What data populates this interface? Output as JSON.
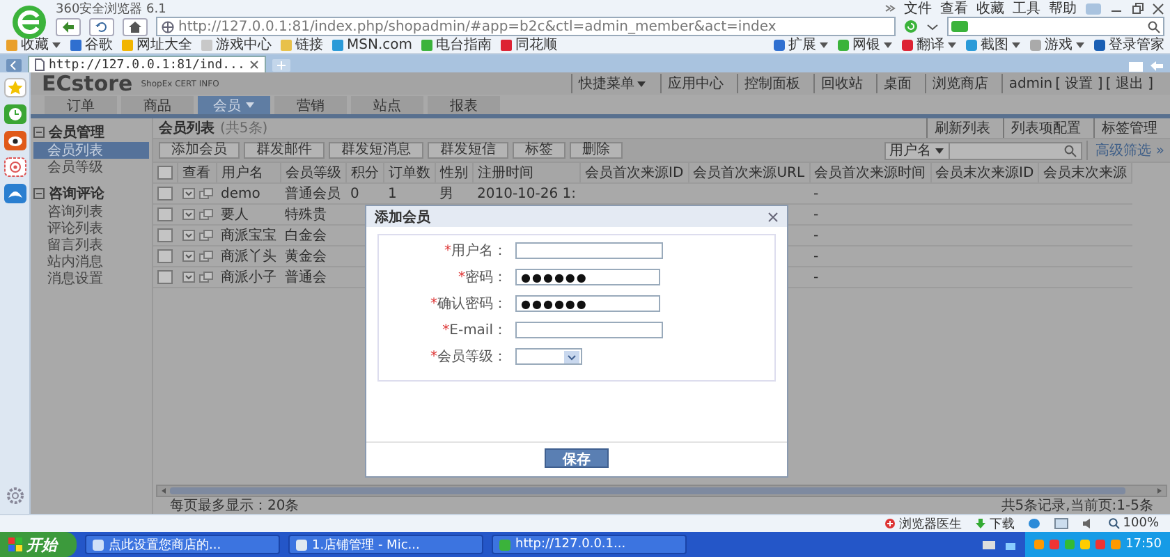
{
  "browser": {
    "title": "360安全浏览器 6.1",
    "menu": [
      "文件",
      "查看",
      "收藏",
      "工具",
      "帮助"
    ],
    "url": "http://127.0.0.1:81/index.php/shopadmin/#app=b2c&ctl=admin_member&act=index",
    "favorites": [
      {
        "label": "收藏",
        "dropdown": true
      },
      {
        "label": "谷歌",
        "dropdown": false
      },
      {
        "label": "网址大全",
        "dropdown": false
      },
      {
        "label": "游戏中心",
        "dropdown": false
      },
      {
        "label": "链接",
        "dropdown": false
      },
      {
        "label": "MSN.com",
        "dropdown": false
      },
      {
        "label": "电台指南",
        "dropdown": false
      },
      {
        "label": "同花顺",
        "dropdown": false
      }
    ],
    "tools": [
      "扩展",
      "网银",
      "翻译",
      "截图",
      "游戏",
      "登录管家"
    ],
    "tabs": [
      {
        "title": "http://127.0.0.1:81/ind...",
        "selected": true
      }
    ]
  },
  "app": {
    "logo": "ECstore",
    "subtitle": "ShopEx CERT INFO",
    "quick_menu": "快捷菜单",
    "top_links": [
      "应用中心",
      "控制面板",
      "回收站",
      "桌面",
      "浏览商店"
    ],
    "user": "admin",
    "user_links": [
      "[ 设置 ]",
      "[ 退出 ]"
    ],
    "nav": [
      {
        "label": "订单",
        "selected": false
      },
      {
        "label": "商品",
        "selected": false
      },
      {
        "label": "会员",
        "selected": true
      },
      {
        "label": "营销",
        "selected": false
      },
      {
        "label": "站点",
        "selected": false
      },
      {
        "label": "报表",
        "selected": false
      }
    ],
    "sidebar": [
      {
        "title": "会员管理",
        "expanded": true,
        "items": [
          {
            "label": "会员列表",
            "selected": true
          },
          {
            "label": "会员等级",
            "selected": false
          }
        ]
      },
      {
        "title": "咨询评论",
        "expanded": true,
        "items": [
          {
            "label": "咨询列表",
            "selected": false
          },
          {
            "label": "评论列表",
            "selected": false
          },
          {
            "label": "留言列表",
            "selected": false
          },
          {
            "label": "站内消息",
            "selected": false
          },
          {
            "label": "消息设置",
            "selected": false
          }
        ]
      }
    ],
    "list": {
      "title": "会员列表",
      "count": "(共5条)",
      "links": [
        "刷新列表",
        "列表项配置",
        "标签管理"
      ],
      "buttons": [
        "添加会员",
        "群发邮件",
        "群发短消息",
        "群发短信",
        "标签",
        "删除"
      ],
      "search_field": "用户名",
      "advanced_filter": "高级筛选 »",
      "all_checked": false,
      "columns": [
        {
          "kind": "actions",
          "label": "查看"
        },
        {
          "kind": "text",
          "label": "用户名"
        },
        {
          "kind": "text",
          "label": "会员等级"
        },
        {
          "kind": "text",
          "label": "积分"
        },
        {
          "kind": "text",
          "label": "订单数"
        },
        {
          "kind": "text",
          "label": "性别"
        },
        {
          "kind": "text",
          "label": "注册时间"
        },
        {
          "kind": "text",
          "label": "会员首次来源ID"
        },
        {
          "kind": "text",
          "label": "会员首次来源URL"
        },
        {
          "kind": "text",
          "label": "会员首次来源时间"
        },
        {
          "kind": "text",
          "label": "会员末次来源ID"
        },
        {
          "kind": "text",
          "label": "会员末次来源"
        }
      ],
      "rows": [
        {
          "checked": false,
          "cells": [
            "",
            "demo",
            "普通会员",
            "0",
            "1",
            "男",
            "2010-10-26 1:",
            "",
            "",
            "-"
          ]
        },
        {
          "checked": false,
          "cells": [
            "",
            "要人",
            "特殊贵",
            "",
            "",
            "",
            "",
            "",
            "",
            "-"
          ]
        },
        {
          "checked": false,
          "cells": [
            "",
            "商派宝宝",
            "白金会",
            "",
            "",
            "",
            "",
            "",
            "",
            "-"
          ]
        },
        {
          "checked": false,
          "cells": [
            "",
            "商派丫头",
            "黄金会",
            "",
            "",
            "",
            "",
            "",
            "",
            "-"
          ]
        },
        {
          "checked": false,
          "cells": [
            "",
            "商派小子",
            "普通会",
            "",
            "",
            "",
            "",
            "",
            "",
            "-"
          ]
        }
      ],
      "page_size": "每页最多显示：20条",
      "summary": "共5条记录,当前页:1-5条"
    }
  },
  "dialog": {
    "title": "添加会员",
    "fields": [
      {
        "kind": "text",
        "label": "用户名：",
        "required_mark": "*"
      },
      {
        "kind": "password",
        "label": "密码：",
        "required_mark": "*",
        "value": "●●●●●●"
      },
      {
        "kind": "password",
        "label": "确认密码：",
        "required_mark": "*",
        "value": "●●●●●●"
      },
      {
        "kind": "text",
        "label": "E-mail：",
        "required_mark": "*"
      },
      {
        "kind": "select",
        "label": "会员等级：",
        "required_mark": "*"
      }
    ],
    "button": "保存"
  },
  "status_bar": {
    "items": [
      "浏览器医生",
      "下载"
    ],
    "zoom": "100%"
  },
  "taskbar": {
    "start": "开始",
    "tasks": [
      "点此设置您商店的...",
      "1.店铺管理 - Mic...",
      "http://127.0.0.1..."
    ],
    "time": "17:50"
  }
}
